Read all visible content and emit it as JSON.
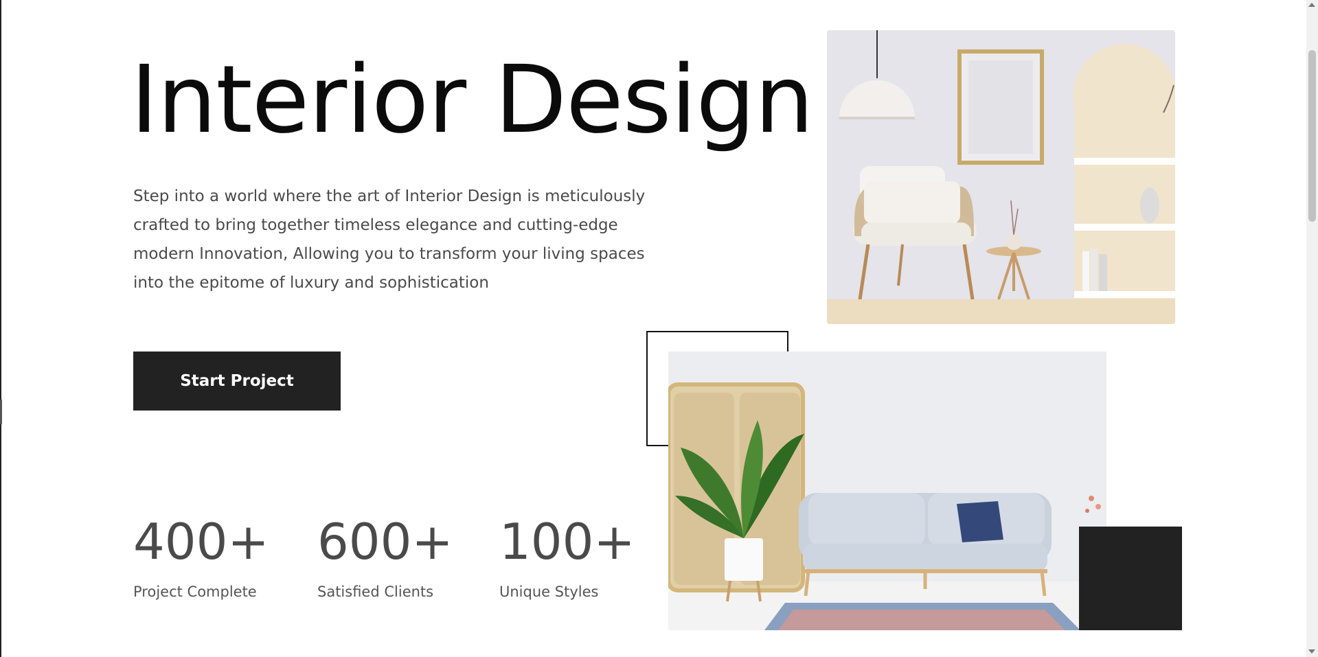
{
  "hero": {
    "title": "Interior Design",
    "description": "Step into a world where the art of Interior Design is meticulously crafted to bring together timeless elegance and cutting-edge modern Innovation, Allowing you to transform your living spaces into the epitome of luxury and sophistication",
    "cta_label": "Start Project"
  },
  "stats": [
    {
      "value": "400+",
      "label": "Project Complete"
    },
    {
      "value": "600+",
      "label": "Satisfied Clients"
    },
    {
      "value": "100+",
      "label": "Unique Styles"
    }
  ],
  "images": {
    "top": "living-room-armchair-photo",
    "bottom": "living-room-sofa-photo"
  },
  "colors": {
    "accent_dark": "#222222",
    "text_muted": "#4a4a4a"
  }
}
